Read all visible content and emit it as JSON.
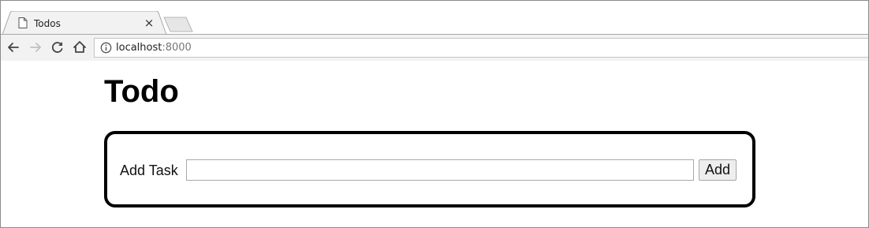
{
  "browser": {
    "tab": {
      "title": "Todos",
      "close_glyph": "×",
      "icon": "page-icon"
    },
    "newtab_icon": "new-tab-icon",
    "toolbar": {
      "back_icon": "back-arrow-icon",
      "forward_icon": "forward-arrow-icon",
      "reload_icon": "reload-icon",
      "home_icon": "home-icon",
      "info_icon": "info-icon"
    },
    "address": {
      "host": "localhost",
      "port": ":8000"
    }
  },
  "page": {
    "title": "Todo",
    "form": {
      "label": "Add Task",
      "input_value": "",
      "button_label": "Add"
    }
  },
  "colors": {
    "toolbar_bg": "#f2f2f2",
    "form_border": "#000000",
    "port_text": "#777777"
  }
}
